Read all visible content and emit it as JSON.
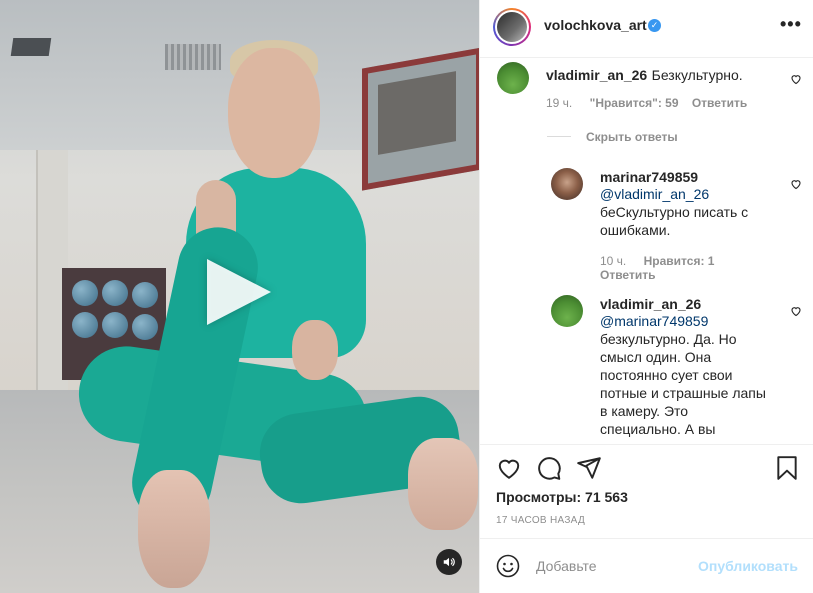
{
  "post": {
    "username": "volochkova_art",
    "views_label": "Просмотры: 71 563",
    "time_ago": "17 ЧАСОВ НАЗАД"
  },
  "comments": [
    {
      "user": "vladimir_an_26",
      "text": "Безкультурно.",
      "time": "19 ч.",
      "likes": "\"Нравится\": 59",
      "reply": "Ответить",
      "hide_replies": "Скрыть ответы"
    },
    {
      "user": "marinar749859",
      "mention": "@vladimir_an_26",
      "text_lines": [
        "беСкультурно писать с",
        "ошибками."
      ],
      "time": "10 ч.",
      "likes": "Нравится: 1",
      "reply": "Ответить"
    },
    {
      "user": "vladimir_an_26",
      "mention": "@marinar749859",
      "text_lines": [
        "безкультурно. Да. Но",
        "смысл один. Она",
        "постоянно сует свои",
        "потные и страшные лапы",
        "в камеру. Это",
        "специально. А вы"
      ]
    }
  ],
  "composer": {
    "placeholder": "Добавьте",
    "post_label": "Опубликовать"
  },
  "icons": {
    "more": "more-icon",
    "verified": "verified-badge-icon",
    "like": "heart-icon",
    "comment": "comment-icon",
    "share": "share-icon",
    "save": "bookmark-icon",
    "emoji": "emoji-icon",
    "sound": "sound-icon",
    "play": "play-icon"
  },
  "colors": {
    "verified": "#3897f0",
    "mention": "#00376b",
    "post_disabled": "#b2dffc"
  }
}
